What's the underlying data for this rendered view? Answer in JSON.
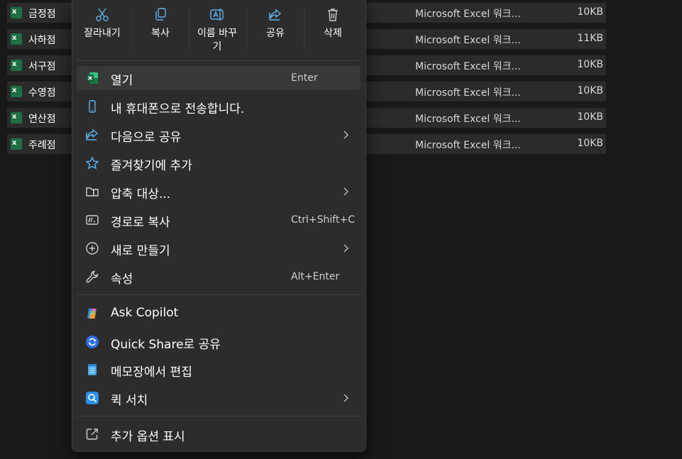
{
  "files": [
    {
      "name": "금정점",
      "type": "Microsoft Excel 워크...",
      "size": "10KB"
    },
    {
      "name": "사하점",
      "type": "Microsoft Excel 워크...",
      "size": "11KB"
    },
    {
      "name": "서구점",
      "type": "Microsoft Excel 워크...",
      "size": "10KB"
    },
    {
      "name": "수영점",
      "type": "Microsoft Excel 워크...",
      "size": "10KB"
    },
    {
      "name": "연산점",
      "type": "Microsoft Excel 워크...",
      "size": "10KB"
    },
    {
      "name": "주례점",
      "type": "Microsoft Excel 워크...",
      "size": "10KB"
    }
  ],
  "quick_actions": [
    {
      "label": "잘라내기",
      "icon": "scissors-icon"
    },
    {
      "label": "복사",
      "icon": "copy-icon"
    },
    {
      "label": "이름 바꾸\n기",
      "icon": "rename-icon"
    },
    {
      "label": "공유",
      "icon": "share-icon"
    },
    {
      "label": "삭제",
      "icon": "trash-icon"
    }
  ],
  "menu_items": [
    {
      "label": "열기",
      "shortcut": "Enter",
      "icon": "excel-icon",
      "selected": true
    },
    {
      "label": "내 휴대폰으로 전송합니다.",
      "icon": "phone-icon"
    },
    {
      "label": "다음으로 공유",
      "icon": "share-icon",
      "submenu": true
    },
    {
      "label": "즐겨찾기에 추가",
      "icon": "star-icon"
    },
    {
      "label": "압축 대상...",
      "icon": "zip-folder-icon",
      "submenu": true
    },
    {
      "label": "경로로 복사",
      "shortcut": "Ctrl+Shift+C",
      "icon": "copy-path-icon"
    },
    {
      "label": "새로 만들기",
      "icon": "plus-circle-icon",
      "submenu": true
    },
    {
      "label": "속성",
      "shortcut": "Alt+Enter",
      "icon": "wrench-icon"
    },
    {
      "label": "Ask Copilot",
      "icon": "copilot-icon"
    },
    {
      "label": "Quick Share로 공유",
      "icon": "quick-share-icon"
    },
    {
      "label": "메모장에서 편집",
      "icon": "notepad-icon"
    },
    {
      "label": "퀵 서치",
      "icon": "quick-search-icon",
      "submenu": true
    },
    {
      "label": "추가 옵션 표시",
      "icon": "more-options-icon"
    }
  ],
  "colors": {
    "background": "#191919",
    "menu": "#2c2c2c",
    "accent": "#5fb2f2",
    "excel_green": "#1d7044"
  }
}
